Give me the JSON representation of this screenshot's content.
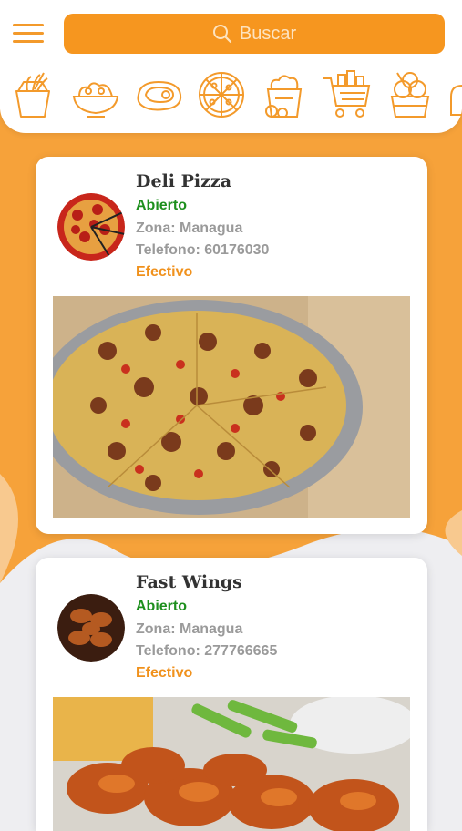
{
  "header": {
    "search_placeholder": "Buscar",
    "menu_icon": "hamburger-menu-icon",
    "search_icon": "search-icon"
  },
  "categories": [
    {
      "icon": "noodles-box-icon"
    },
    {
      "icon": "salad-bowl-icon"
    },
    {
      "icon": "steak-icon"
    },
    {
      "icon": "pizza-icon"
    },
    {
      "icon": "fried-chicken-bucket-icon"
    },
    {
      "icon": "shopping-cart-icon"
    },
    {
      "icon": "ice-cream-cup-icon"
    },
    {
      "icon": "bread-icon"
    }
  ],
  "restaurants": [
    {
      "name": "Deli Pizza",
      "status": "Abierto",
      "zone": "Zona: Managua",
      "phone": "Telefono: 60176030",
      "payment": "Efectivo"
    },
    {
      "name": "Fast Wings",
      "status": "Abierto",
      "zone": "Zona: Managua",
      "phone": "Telefono: 277766665",
      "payment": "Efectivo"
    }
  ],
  "colors": {
    "accent": "#f6961f",
    "open_status": "#1d8f1d",
    "payment": "#f0911c",
    "muted_text": "#9a9a9a"
  }
}
